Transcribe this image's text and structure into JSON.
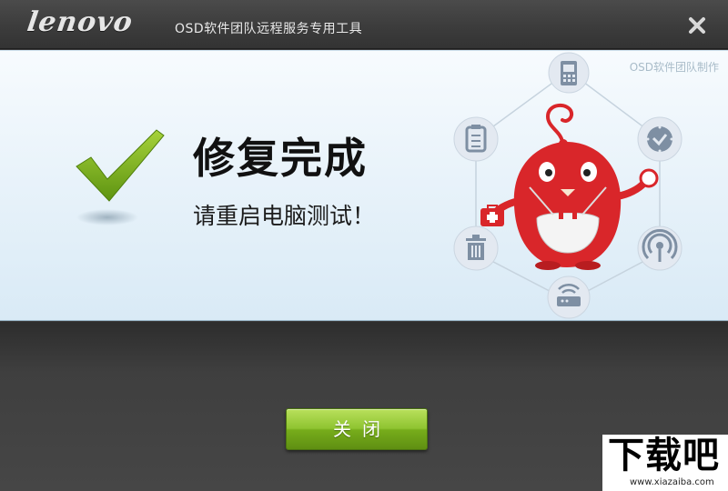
{
  "window": {
    "brand": "lenovo",
    "title": "OSD软件团队远程服务专用工具",
    "close_icon": "close-icon"
  },
  "result": {
    "heading": "修复完成",
    "message": "请重启电脑测试！",
    "team_credit": "OSD软件团队制作",
    "status_icon": "checkmark-icon"
  },
  "actions": {
    "close_label": "关闭"
  },
  "watermark": {
    "main": "下载吧",
    "sub": "www.xiazaiba.com"
  },
  "colors": {
    "titlebar": "#3c3c3c",
    "panel": "#e6f1f9",
    "check_green": "#7fb21a",
    "button_green": "#8fc431",
    "mascot_red": "#d9262a",
    "orbit_icon_bg": "#e3e9f1"
  }
}
